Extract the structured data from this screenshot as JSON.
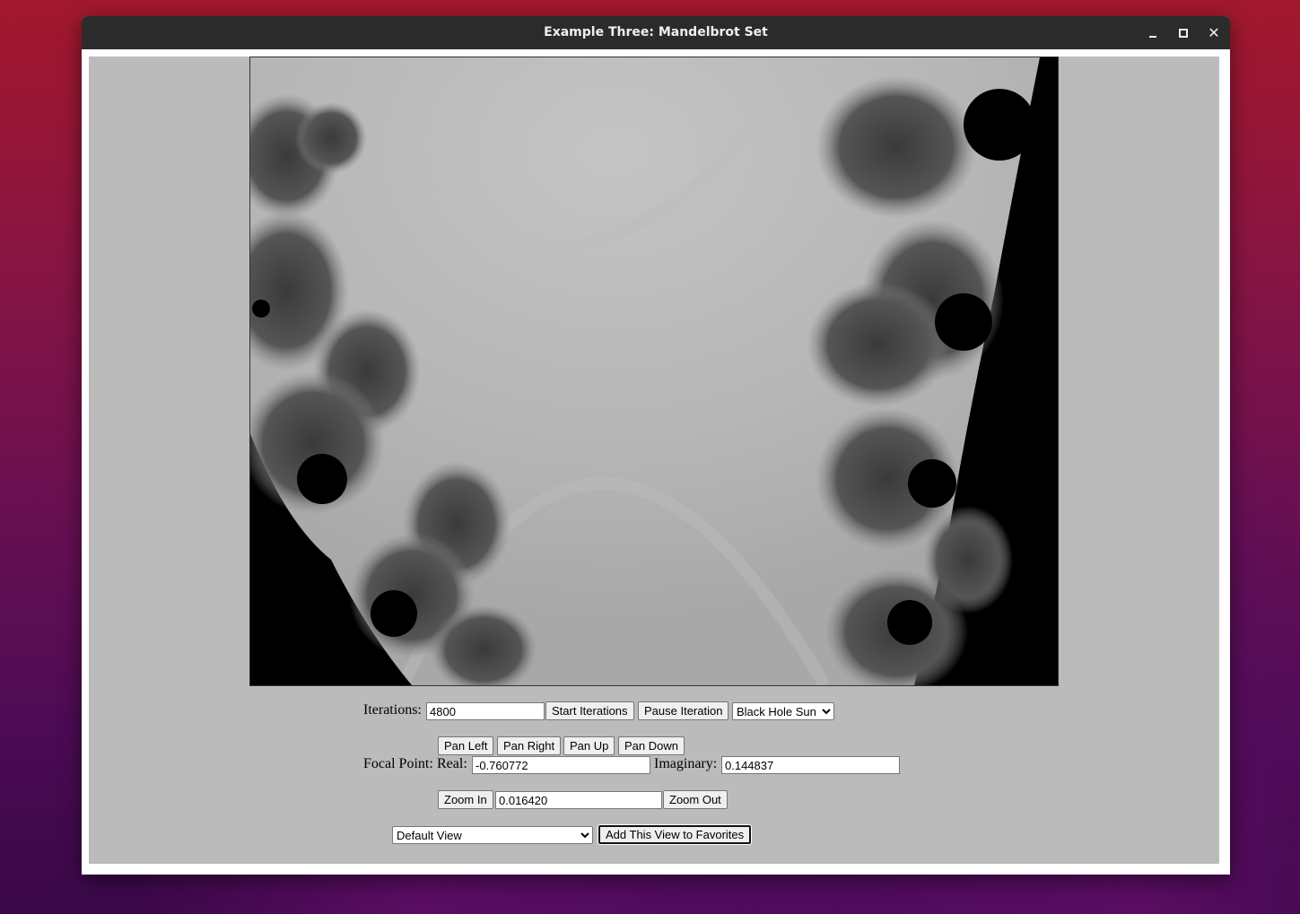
{
  "window": {
    "title": "Example Three: Mandelbrot Set",
    "close_glyph": "✕"
  },
  "iterations": {
    "label": "Iterations:",
    "value": "4800",
    "start_label": "Start Iterations",
    "pause_label": "Pause Iteration",
    "palette_selected": "Black Hole Sun"
  },
  "pan": {
    "left_label": "Pan Left",
    "right_label": "Pan Right",
    "up_label": "Pan Up",
    "down_label": "Pan Down"
  },
  "focal": {
    "label": "Focal Point:",
    "real_label": "Real:",
    "real_value": "-0.760772",
    "imag_label": "Imaginary:",
    "imag_value": "0.144837"
  },
  "zoom": {
    "in_label": "Zoom In",
    "value": "0.016420",
    "out_label": "Zoom Out"
  },
  "favorites": {
    "view_selected": "Default View",
    "add_label": "Add This View to Favorites"
  }
}
